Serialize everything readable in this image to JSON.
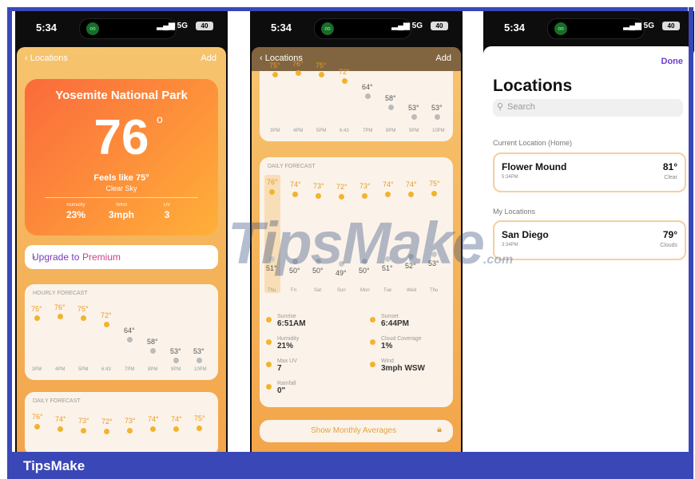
{
  "footer_brand": "TipsMake",
  "watermark": {
    "main": "TipsMake",
    "suffix": ".com"
  },
  "status": {
    "time": "5:34",
    "signal": "5G",
    "battery": "40"
  },
  "left": {
    "nav": {
      "back": "Locations",
      "add": "Add"
    },
    "hero": {
      "park": "Yosemite National Park",
      "temp": "76",
      "feels": "Feels like 75°",
      "sky": "Clear Sky",
      "stats": [
        {
          "label": "Humidity",
          "value": "23%"
        },
        {
          "label": "Wind",
          "value": "3mph"
        },
        {
          "label": "UV",
          "value": "3"
        }
      ]
    },
    "upgrade": {
      "text": "Upgrade to",
      "premium": "Premium"
    },
    "hourly": {
      "title": "HOURLY FORECAST",
      "temps": [
        "75°",
        "76°",
        "75°",
        "72°",
        "64°",
        "58°",
        "53°",
        "53°"
      ],
      "times": [
        "3PM",
        "4PM",
        "5PM",
        "6:43",
        "7PM",
        "8PM",
        "9PM",
        "10PM"
      ]
    },
    "daily": {
      "title": "DAILY FORECAST",
      "temps": [
        "76°",
        "74°",
        "73°",
        "72°",
        "73°",
        "74°",
        "74°",
        "75°"
      ]
    }
  },
  "middle": {
    "nav": {
      "back": "Locations",
      "add": "Add"
    },
    "hourly_temps": [
      "75°",
      "76°",
      "75°",
      "72°",
      "64°",
      "58°",
      "53°",
      "53°"
    ],
    "hourly_times": [
      "3PM",
      "4PM",
      "5PM",
      "6:43",
      "7PM",
      "8PM",
      "9PM",
      "10PM"
    ],
    "daily": {
      "title": "DAILY FORECAST",
      "highs": [
        "76°",
        "74°",
        "73°",
        "72°",
        "73°",
        "74°",
        "74°",
        "75°"
      ],
      "lows": [
        "51°",
        "50°",
        "50°",
        "49°",
        "50°",
        "51°",
        "52°",
        "53°"
      ],
      "days": [
        "Thu",
        "Fri",
        "Sat",
        "Sun",
        "Mon",
        "Tue",
        "Wed",
        "Thu"
      ]
    },
    "details": [
      {
        "label": "Sunrise",
        "value": "6:51AM"
      },
      {
        "label": "Sunset",
        "value": "6:44PM"
      },
      {
        "label": "Humidity",
        "value": "21%"
      },
      {
        "label": "Cloud Coverage",
        "value": "1%"
      },
      {
        "label": "Max UV",
        "value": "7"
      },
      {
        "label": "Wind",
        "value": "3mph WSW"
      },
      {
        "label": "Rainfall",
        "value": "0\""
      }
    ],
    "monthly": "Show Monthly Averages"
  },
  "right": {
    "done": "Done",
    "title": "Locations",
    "search_placeholder": "Search",
    "current_section": "Current Location (Home)",
    "current": {
      "name": "Flower Mound",
      "time": "5:34PM",
      "temp": "81°",
      "cond": "Clear"
    },
    "my_section": "My Locations",
    "saved": {
      "name": "San Diego",
      "time": "3:34PM",
      "temp": "79°",
      "cond": "Clouds"
    }
  }
}
